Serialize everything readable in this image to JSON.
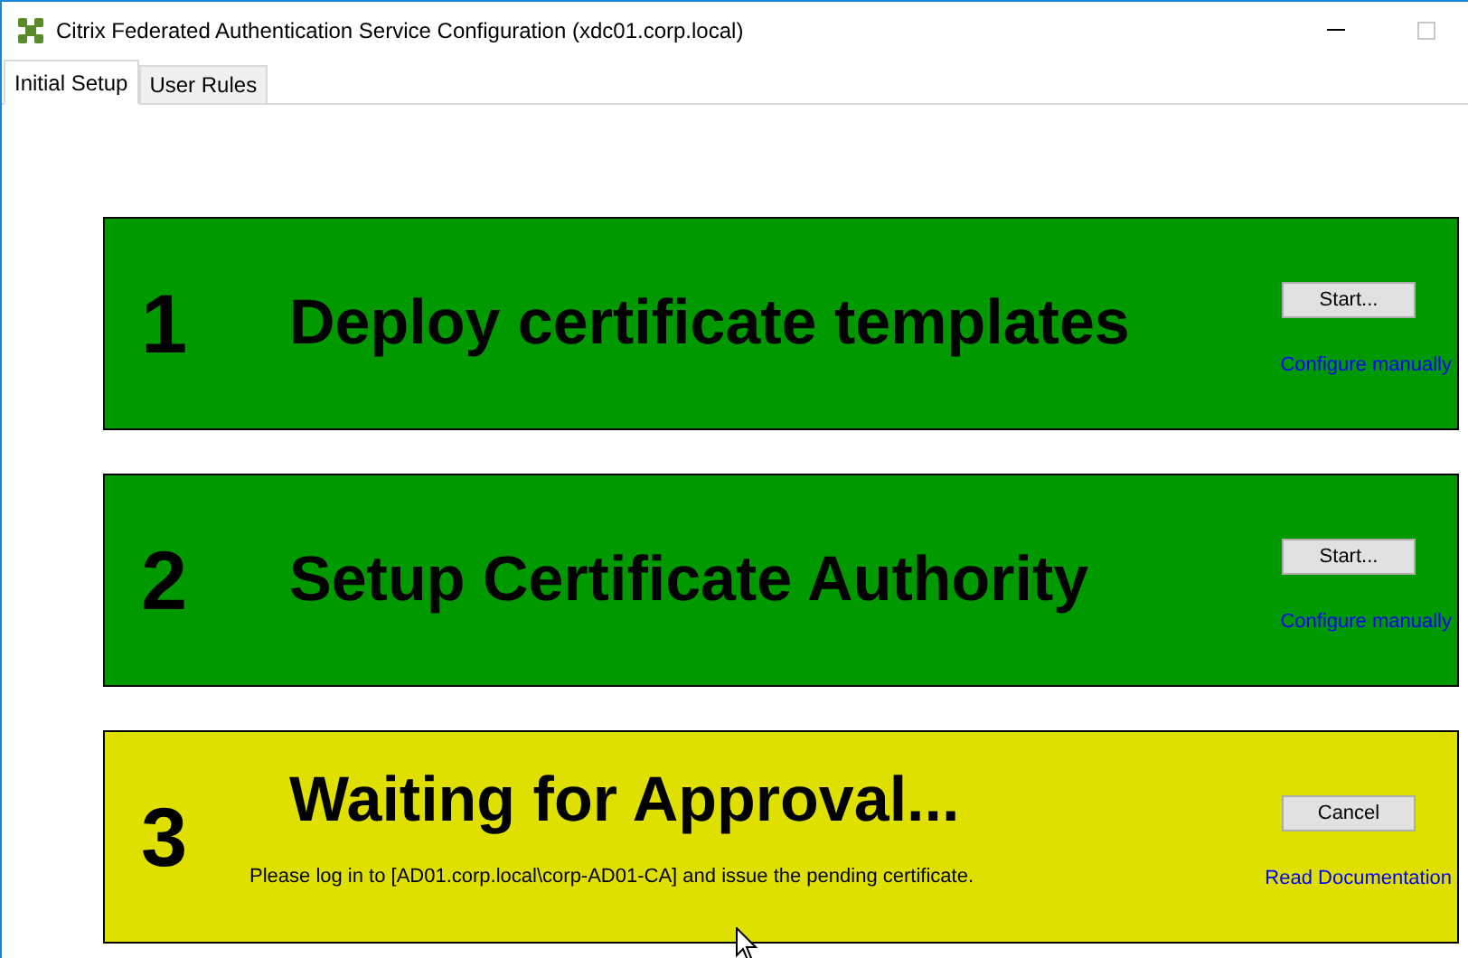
{
  "window": {
    "title": "Citrix Federated Authentication Service Configuration (xdc01.corp.local)"
  },
  "tabs": [
    {
      "label": "Initial Setup",
      "selected": true
    },
    {
      "label": "User Rules",
      "selected": false
    }
  ],
  "steps": [
    {
      "number": "1",
      "title": "Deploy certificate templates",
      "color": "#009900",
      "button": "Start...",
      "link": "Configure manually"
    },
    {
      "number": "2",
      "title": "Setup Certificate Authority",
      "color": "#009900",
      "button": "Start...",
      "link": "Configure manually"
    },
    {
      "number": "3",
      "title": "Waiting for Approval...",
      "color": "#e0e000",
      "button": "Cancel",
      "link": "Read Documentation",
      "description": "Please log in to [AD01.corp.local\\corp-AD01-CA] and issue the pending certificate."
    }
  ]
}
